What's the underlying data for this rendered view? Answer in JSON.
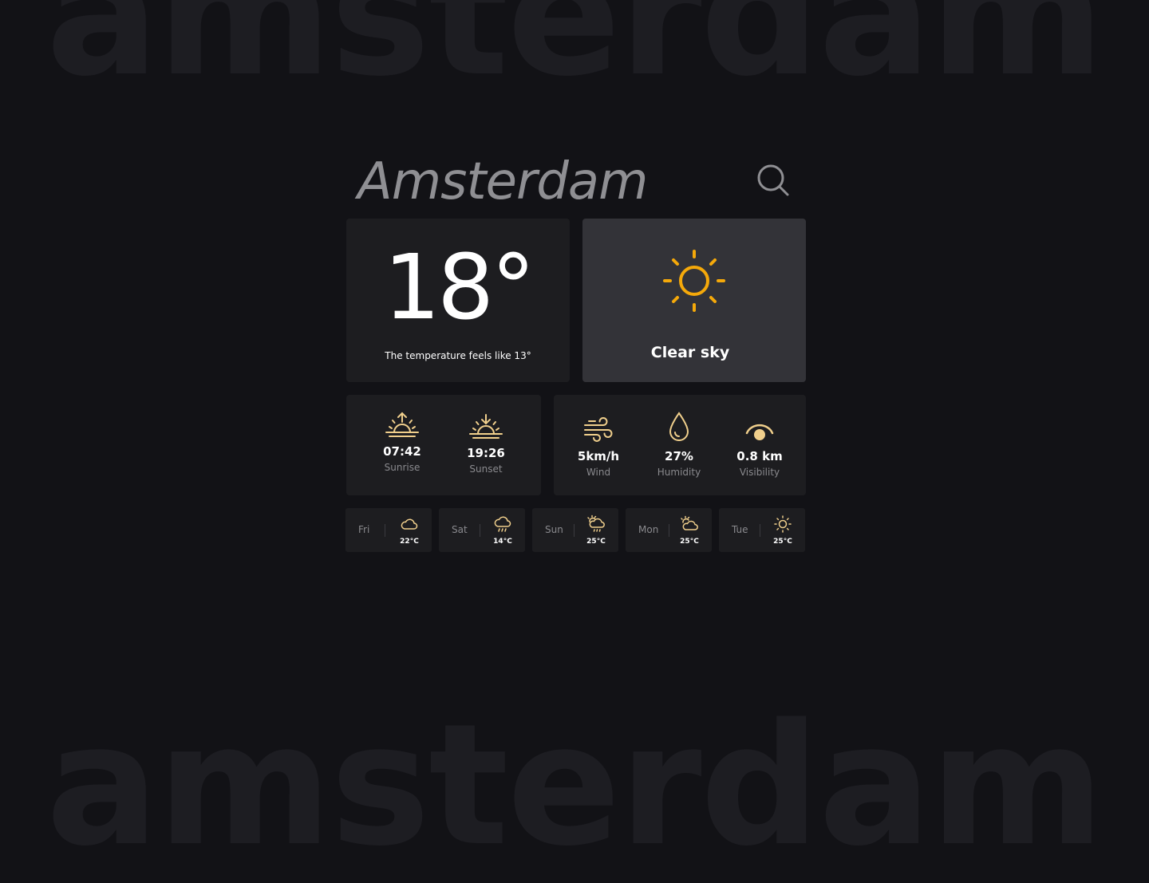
{
  "background_word": "amsterdam",
  "city": "Amsterdam",
  "search": {
    "icon": "search-icon"
  },
  "current": {
    "temperature": "18°",
    "feels_like": "The temperature feels like 13°",
    "condition": "Clear sky",
    "condition_icon": "sun-icon"
  },
  "sun": {
    "sunrise": {
      "value": "07:42",
      "label": "Sunrise",
      "icon": "sunrise-icon"
    },
    "sunset": {
      "value": "19:26",
      "label": "Sunset",
      "icon": "sunset-icon"
    }
  },
  "stats": {
    "wind": {
      "value": "5km/h",
      "label": "Wind",
      "icon": "wind-icon"
    },
    "humidity": {
      "value": "27%",
      "label": "Humidity",
      "icon": "droplet-icon"
    },
    "visibility": {
      "value": "0.8 km",
      "label": "Visibility",
      "icon": "eye-icon"
    }
  },
  "forecast": [
    {
      "day": "Fri",
      "temp": "22°C",
      "icon": "cloud-icon"
    },
    {
      "day": "Sat",
      "temp": "14°C",
      "icon": "rain-cloud-icon"
    },
    {
      "day": "Sun",
      "temp": "25°C",
      "icon": "sun-rain-cloud-icon"
    },
    {
      "day": "Mon",
      "temp": "25°C",
      "icon": "partly-cloudy-icon"
    },
    {
      "day": "Tue",
      "temp": "25°C",
      "icon": "sun-icon"
    }
  ],
  "colors": {
    "background": "#121216",
    "card": "#1d1d20",
    "card_highlight": "#333338",
    "accent_sun": "#f5a90a",
    "icon_warm": "#f0cf8c",
    "muted_text": "#8a8a8e"
  }
}
